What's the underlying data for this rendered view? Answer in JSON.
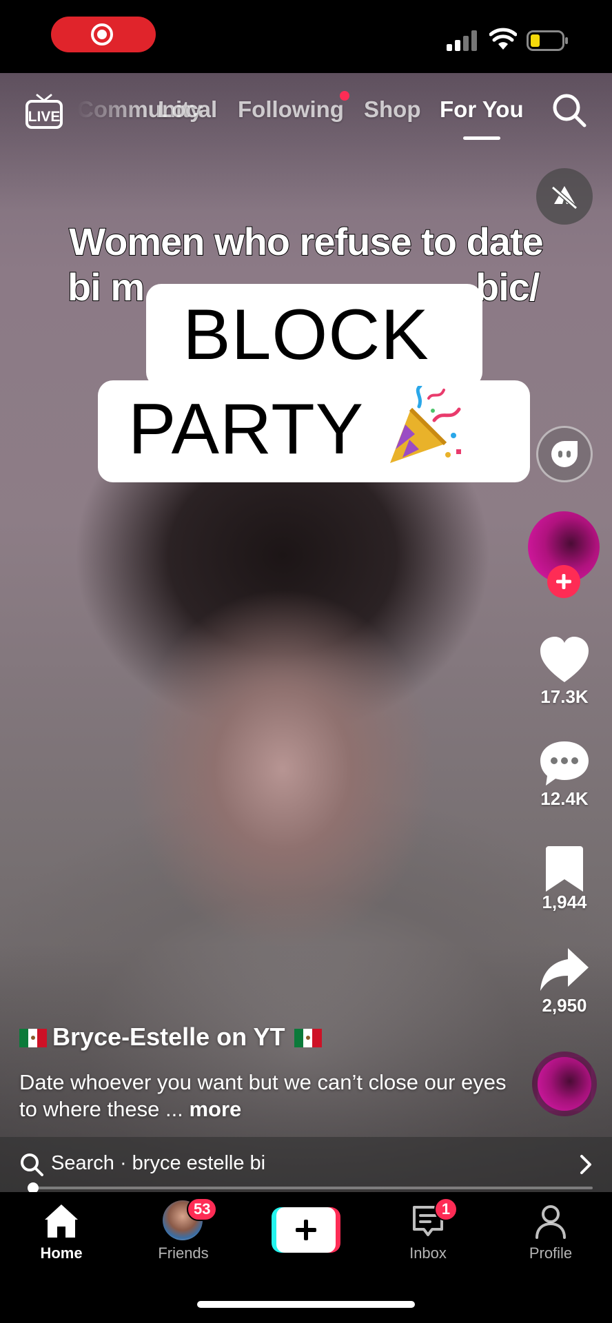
{
  "topnav": {
    "live_label": "LIVE",
    "tabs": [
      {
        "label": "Community"
      },
      {
        "label": "Local"
      },
      {
        "label": "Following"
      },
      {
        "label": "Shop"
      },
      {
        "label": "For You"
      }
    ],
    "active_tab": "For You",
    "following_has_new": true
  },
  "video": {
    "overlay_caption_line1": "Women who refuse to date",
    "overlay_caption_line2": "bi m",
    "overlay_caption_line2_tail": "bic/",
    "sticker_line1": "BLOCK",
    "sticker_line2": "PARTY",
    "sticker_icon": "party-popper-icon"
  },
  "rail": {
    "likes": "17.3K",
    "comments": "12.4K",
    "saves": "1,944",
    "shares": "2,950"
  },
  "post": {
    "username": "Bryce-Estelle on YT",
    "description": "Date whoever you want but we can’t close our eyes to where these ...",
    "more_label": "more"
  },
  "search": {
    "text": "Search · bryce estelle bi",
    "progress": 0.01
  },
  "tabbar": {
    "home": "Home",
    "friends": "Friends",
    "friends_badge": "53",
    "inbox": "Inbox",
    "inbox_badge": "1",
    "profile": "Profile"
  },
  "colors": {
    "accent": "#fe2c55",
    "accent_secondary": "#25f4ee",
    "recording_pill": "#e0242b",
    "battery_low": "#f5d90a"
  }
}
